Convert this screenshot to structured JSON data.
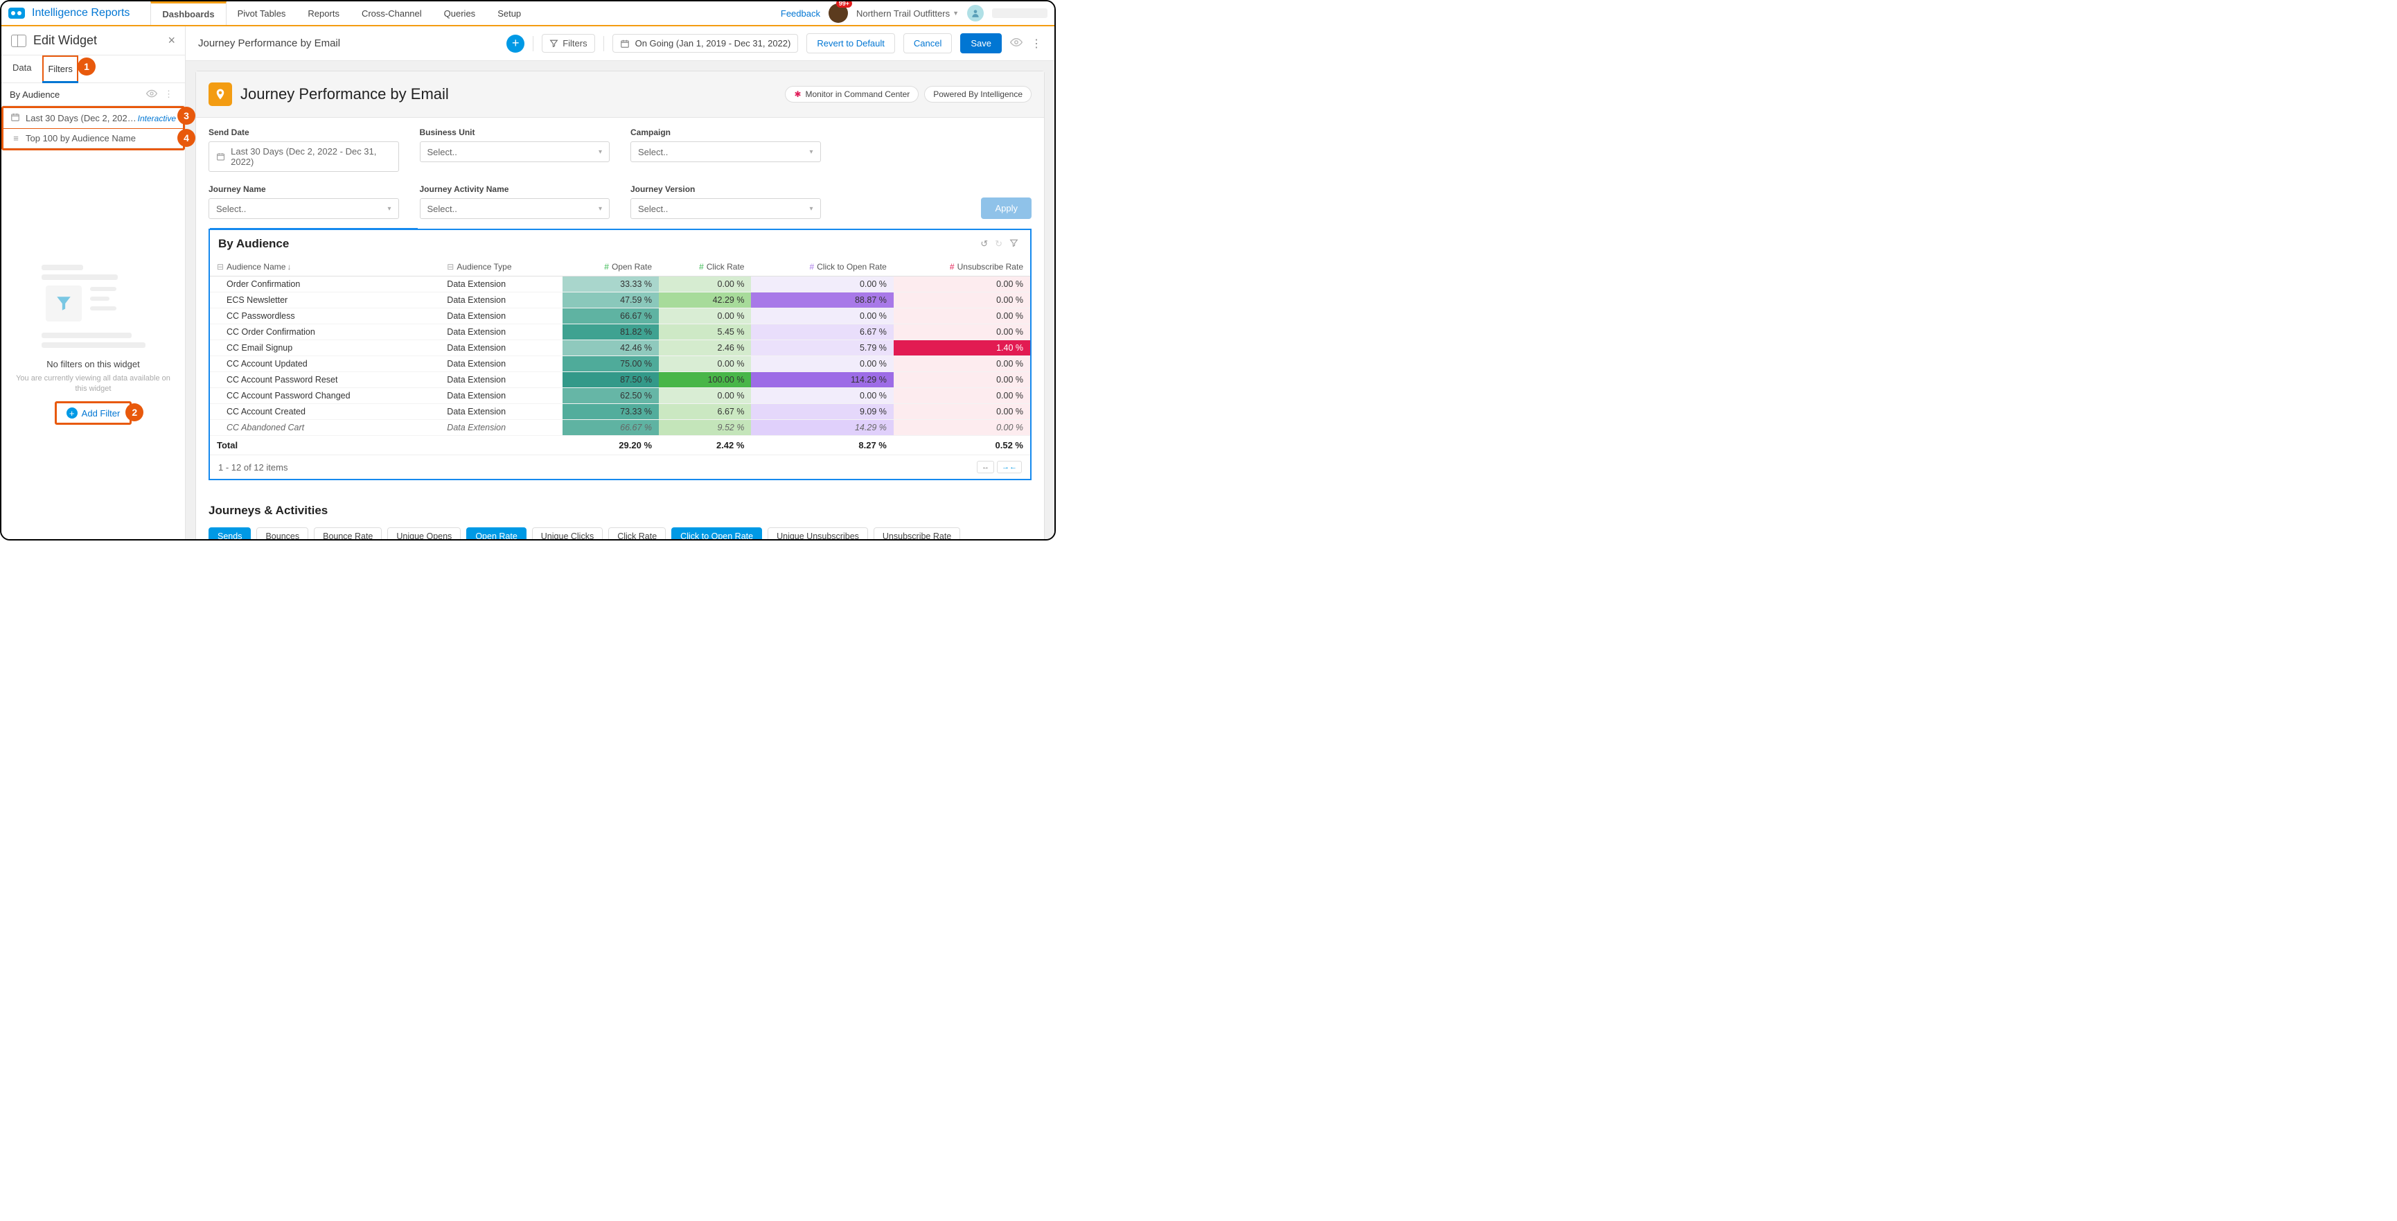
{
  "brand": "Intelligence Reports",
  "nav": {
    "tabs": [
      "Dashboards",
      "Pivot Tables",
      "Reports",
      "Cross-Channel",
      "Queries",
      "Setup"
    ],
    "active": "Dashboards"
  },
  "top": {
    "feedback": "Feedback",
    "badge": "99+",
    "org": "Northern Trail Outfitters"
  },
  "sidebar": {
    "title": "Edit Widget",
    "tabs": {
      "data": "Data",
      "filters": "Filters"
    },
    "section": "By Audience",
    "filter1": {
      "label": "Last 30 Days (Dec 2, 2022 - …",
      "tag": "Interactive"
    },
    "filter2": {
      "label": "Top 100 by Audience Name"
    },
    "empty": {
      "title": "No filters on this widget",
      "sub": "You are currently viewing all data available on this widget",
      "cta": "Add Filter"
    }
  },
  "callouts": {
    "c1": "1",
    "c2": "2",
    "c3": "3",
    "c4": "4"
  },
  "mainHeader": {
    "title": "Journey Performance by Email",
    "filters": "Filters",
    "dateRange": "On Going (Jan 1, 2019 - Dec 31, 2022)",
    "revert": "Revert to Default",
    "cancel": "Cancel",
    "save": "Save"
  },
  "page": {
    "title": "Journey Performance by Email",
    "pill1": "Monitor in Command Center",
    "pill2": "Powered By Intelligence"
  },
  "filtersGrid": {
    "sendDate": {
      "label": "Send Date",
      "value": "Last 30 Days (Dec 2, 2022 - Dec 31, 2022)"
    },
    "bu": {
      "label": "Business Unit",
      "value": "Select.."
    },
    "campaign": {
      "label": "Campaign",
      "value": "Select.."
    },
    "jname": {
      "label": "Journey Name",
      "value": "Select.."
    },
    "jact": {
      "label": "Journey Activity Name",
      "value": "Select.."
    },
    "jver": {
      "label": "Journey Version",
      "value": "Select.."
    },
    "apply": "Apply"
  },
  "widget": {
    "title": "By Audience",
    "cols": {
      "name": "Audience Name",
      "type": "Audience Type",
      "open": "Open Rate",
      "click": "Click Rate",
      "cto": "Click to Open Rate",
      "unsub": "Unsubscribe Rate"
    }
  },
  "rows": [
    {
      "name": "Order Confirmation",
      "type": "Data Extension",
      "open": "33.33 %",
      "click": "0.00 %",
      "cto": "0.00 %",
      "unsub": "0.00 %",
      "c": {
        "o": "#a9d6cc",
        "k": "#d6ecd1",
        "t": "#f2edfb",
        "u": "#fdecef"
      }
    },
    {
      "name": "ECS Newsletter",
      "type": "Data Extension",
      "open": "47.59 %",
      "click": "42.29 %",
      "cto": "88.87 %",
      "unsub": "0.00 %",
      "c": {
        "o": "#8ac8bb",
        "k": "#a7db9a",
        "t": "#a879e8",
        "u": "#fdecef"
      }
    },
    {
      "name": "CC Passwordless",
      "type": "Data Extension",
      "open": "66.67 %",
      "click": "0.00 %",
      "cto": "0.00 %",
      "unsub": "0.00 %",
      "c": {
        "o": "#5fb3a2",
        "k": "#d9edd4",
        "t": "#f2edfb",
        "u": "#fdecef"
      }
    },
    {
      "name": "CC Order Confirmation",
      "type": "Data Extension",
      "open": "81.82 %",
      "click": "5.45 %",
      "cto": "6.67 %",
      "unsub": "0.00 %",
      "c": {
        "o": "#3fa291",
        "k": "#cee9c6",
        "t": "#e9defb",
        "u": "#fdecef"
      }
    },
    {
      "name": "CC Email Signup",
      "type": "Data Extension",
      "open": "42.46 %",
      "click": "2.46 %",
      "cto": "5.79 %",
      "unsub": "1.40 %",
      "c": {
        "o": "#8fc9bd",
        "k": "#d4ebcd",
        "t": "#ebe1fb",
        "u": "#e21b52"
      }
    },
    {
      "name": "CC Account Updated",
      "type": "Data Extension",
      "open": "75.00 %",
      "click": "0.00 %",
      "cto": "0.00 %",
      "unsub": "0.00 %",
      "c": {
        "o": "#4fab9a",
        "k": "#d9edd4",
        "t": "#f2edfb",
        "u": "#fdecef"
      }
    },
    {
      "name": "CC Account Password Reset",
      "type": "Data Extension",
      "open": "87.50 %",
      "click": "100.00 %",
      "cto": "114.29 %",
      "unsub": "0.00 %",
      "c": {
        "o": "#339989",
        "k": "#48b648",
        "t": "#9d6ce6",
        "u": "#fdecef"
      }
    },
    {
      "name": "CC Account Password Changed",
      "type": "Data Extension",
      "open": "62.50 %",
      "click": "0.00 %",
      "cto": "0.00 %",
      "unsub": "0.00 %",
      "c": {
        "o": "#66b6a6",
        "k": "#d9edd4",
        "t": "#f2edfb",
        "u": "#fdecef"
      }
    },
    {
      "name": "CC Account Created",
      "type": "Data Extension",
      "open": "73.33 %",
      "click": "6.67 %",
      "cto": "9.09 %",
      "unsub": "0.00 %",
      "c": {
        "o": "#52ad9c",
        "k": "#cbe8c2",
        "t": "#e5d8fb",
        "u": "#fdecef"
      }
    },
    {
      "name": "CC Abandoned Cart",
      "type": "Data Extension",
      "open": "66.67 %",
      "click": "9.52 %",
      "cto": "14.29 %",
      "unsub": "0.00 %",
      "c": {
        "o": "#5fb3a2",
        "k": "#c4e5ba",
        "t": "#e0d0fb",
        "u": "#fdecef"
      }
    }
  ],
  "totals": {
    "label": "Total",
    "open": "29.20 %",
    "click": "2.42 %",
    "cto": "8.27 %",
    "unsub": "0.52 %"
  },
  "pager": "1 - 12 of 12 items",
  "journeys": {
    "title": "Journeys & Activities",
    "chips": [
      "Sends",
      "Bounces",
      "Bounce Rate",
      "Unique Opens",
      "Open Rate",
      "Unique Clicks",
      "Click Rate",
      "Click to Open Rate",
      "Unique Unsubscribes",
      "Unsubscribe Rate"
    ],
    "active": [
      0,
      4,
      7
    ]
  }
}
